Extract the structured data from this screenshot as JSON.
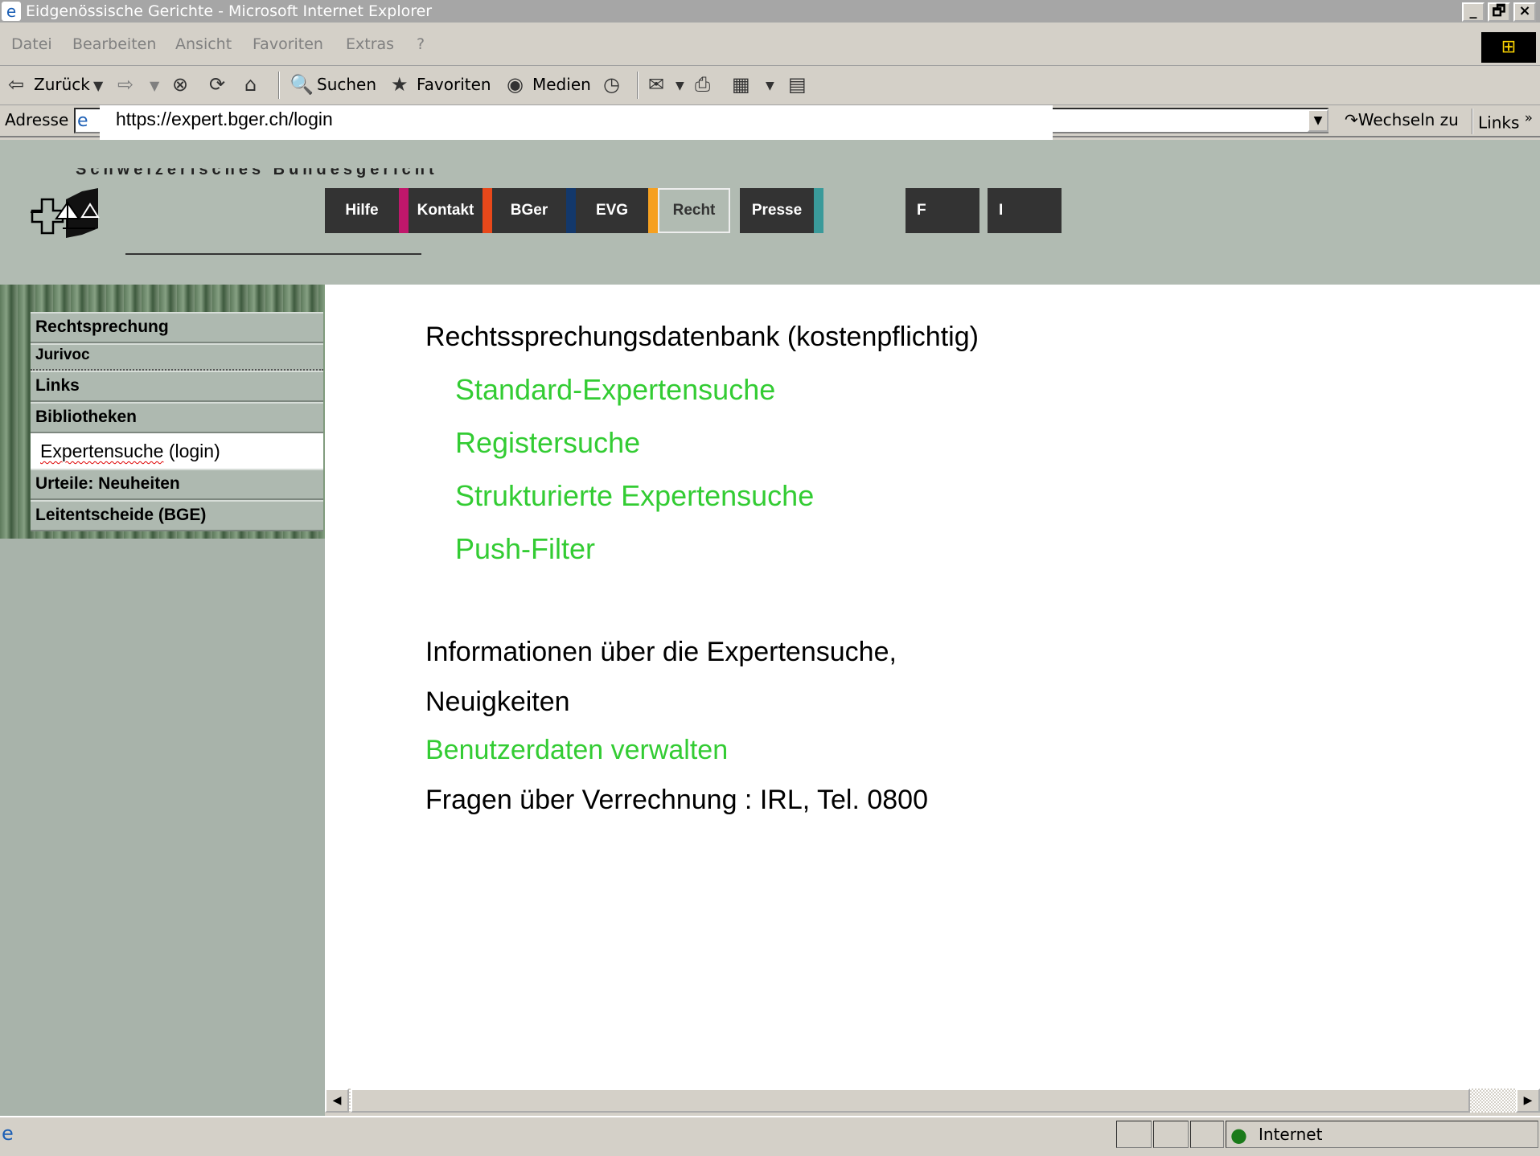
{
  "window": {
    "title": "Eidgenössische Gerichte - Microsoft Internet Explorer",
    "minimize": "_",
    "maximize": "🗗",
    "close": "×"
  },
  "menubar": {
    "items": [
      "Datei",
      "Bearbeiten",
      "Ansicht",
      "Favoriten",
      "Extras",
      "?"
    ]
  },
  "toolbar": {
    "back": "Zurück",
    "search": "Suchen",
    "favorites": "Favoriten",
    "media": "Medien"
  },
  "addressbar": {
    "label": "Adresse",
    "url": "https://expert.bger.ch/login",
    "go": "Wechseln zu",
    "links": "Links",
    "links_more": "»"
  },
  "header": {
    "court_name": "Schweizerisches Bundesgericht",
    "nav": [
      {
        "label": "Hilfe",
        "accent": "#c0176b"
      },
      {
        "label": "Kontakt",
        "accent": "#e8481a"
      },
      {
        "label": "BGer",
        "accent": "#13386b"
      },
      {
        "label": "EVG",
        "accent": "#f6a020"
      },
      {
        "label": "Recht",
        "accent": ""
      },
      {
        "label": "Presse",
        "accent": "#3a9a9a"
      }
    ],
    "lang": [
      "F",
      "I"
    ]
  },
  "sidebar": {
    "items": [
      {
        "label": "Rechtsprechung"
      },
      {
        "label": "Jurivoc"
      },
      {
        "label": "Links"
      },
      {
        "label": "Bibliotheken"
      },
      {
        "label": "Expertensuche",
        "suffix": " (login)"
      },
      {
        "label": "Urteile: Neuheiten"
      },
      {
        "label": "Leitentscheide (BGE)"
      }
    ]
  },
  "main": {
    "heading": "Rechtssprechungsdatenbank (kostenpflichtig)",
    "links": [
      "Standard-Expertensuche",
      "Registersuche",
      "Strukturierte Expertensuche",
      "Push-Filter"
    ],
    "info_line1": "Informationen über die Expertensuche,",
    "info_line2": "Neuigkeiten",
    "account_link": "Benutzerdaten verwalten",
    "billing": "Fragen über Verrechnung : IRL, Tel. 0800"
  },
  "statusbar": {
    "zone": "Internet"
  },
  "colors": {
    "link_green": "#33cc33",
    "header_bg": "#b1bbb2",
    "nav_dark": "#333333"
  }
}
